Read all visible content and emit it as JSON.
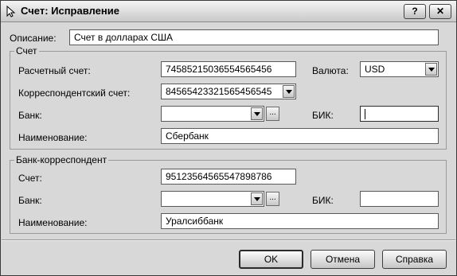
{
  "window": {
    "title": "Счет: Исправление",
    "help_label": "?",
    "close_label": "✕"
  },
  "description": {
    "label": "Описание:",
    "value": "Счет в долларах США"
  },
  "account_group": {
    "legend": "Счет",
    "settlement_account_label": "Расчетный счет:",
    "settlement_account_value": "74585215036554565456",
    "currency_label": "Валюта:",
    "currency_value": "USD",
    "correspondent_account_label": "Корреспондентский счет:",
    "correspondent_account_value": "84565423321565456545",
    "bank_label": "Банк:",
    "bank_value": "",
    "bank_lookup_label": "...",
    "bik_label": "БИК:",
    "bik_value": "",
    "name_label": "Наименование:",
    "name_value": "Сбербанк"
  },
  "correspondent_group": {
    "legend": "Банк-корреспондент",
    "account_label": "Счет:",
    "account_value": "95123564565547898786",
    "bank_label": "Банк:",
    "bank_value": "",
    "bank_lookup_label": "...",
    "bik_label": "БИК:",
    "bik_value": "",
    "name_label": "Наименование:",
    "name_value": "Уралсиббанк"
  },
  "buttons": {
    "ok": "OK",
    "cancel": "Отмена",
    "help": "Справка"
  }
}
